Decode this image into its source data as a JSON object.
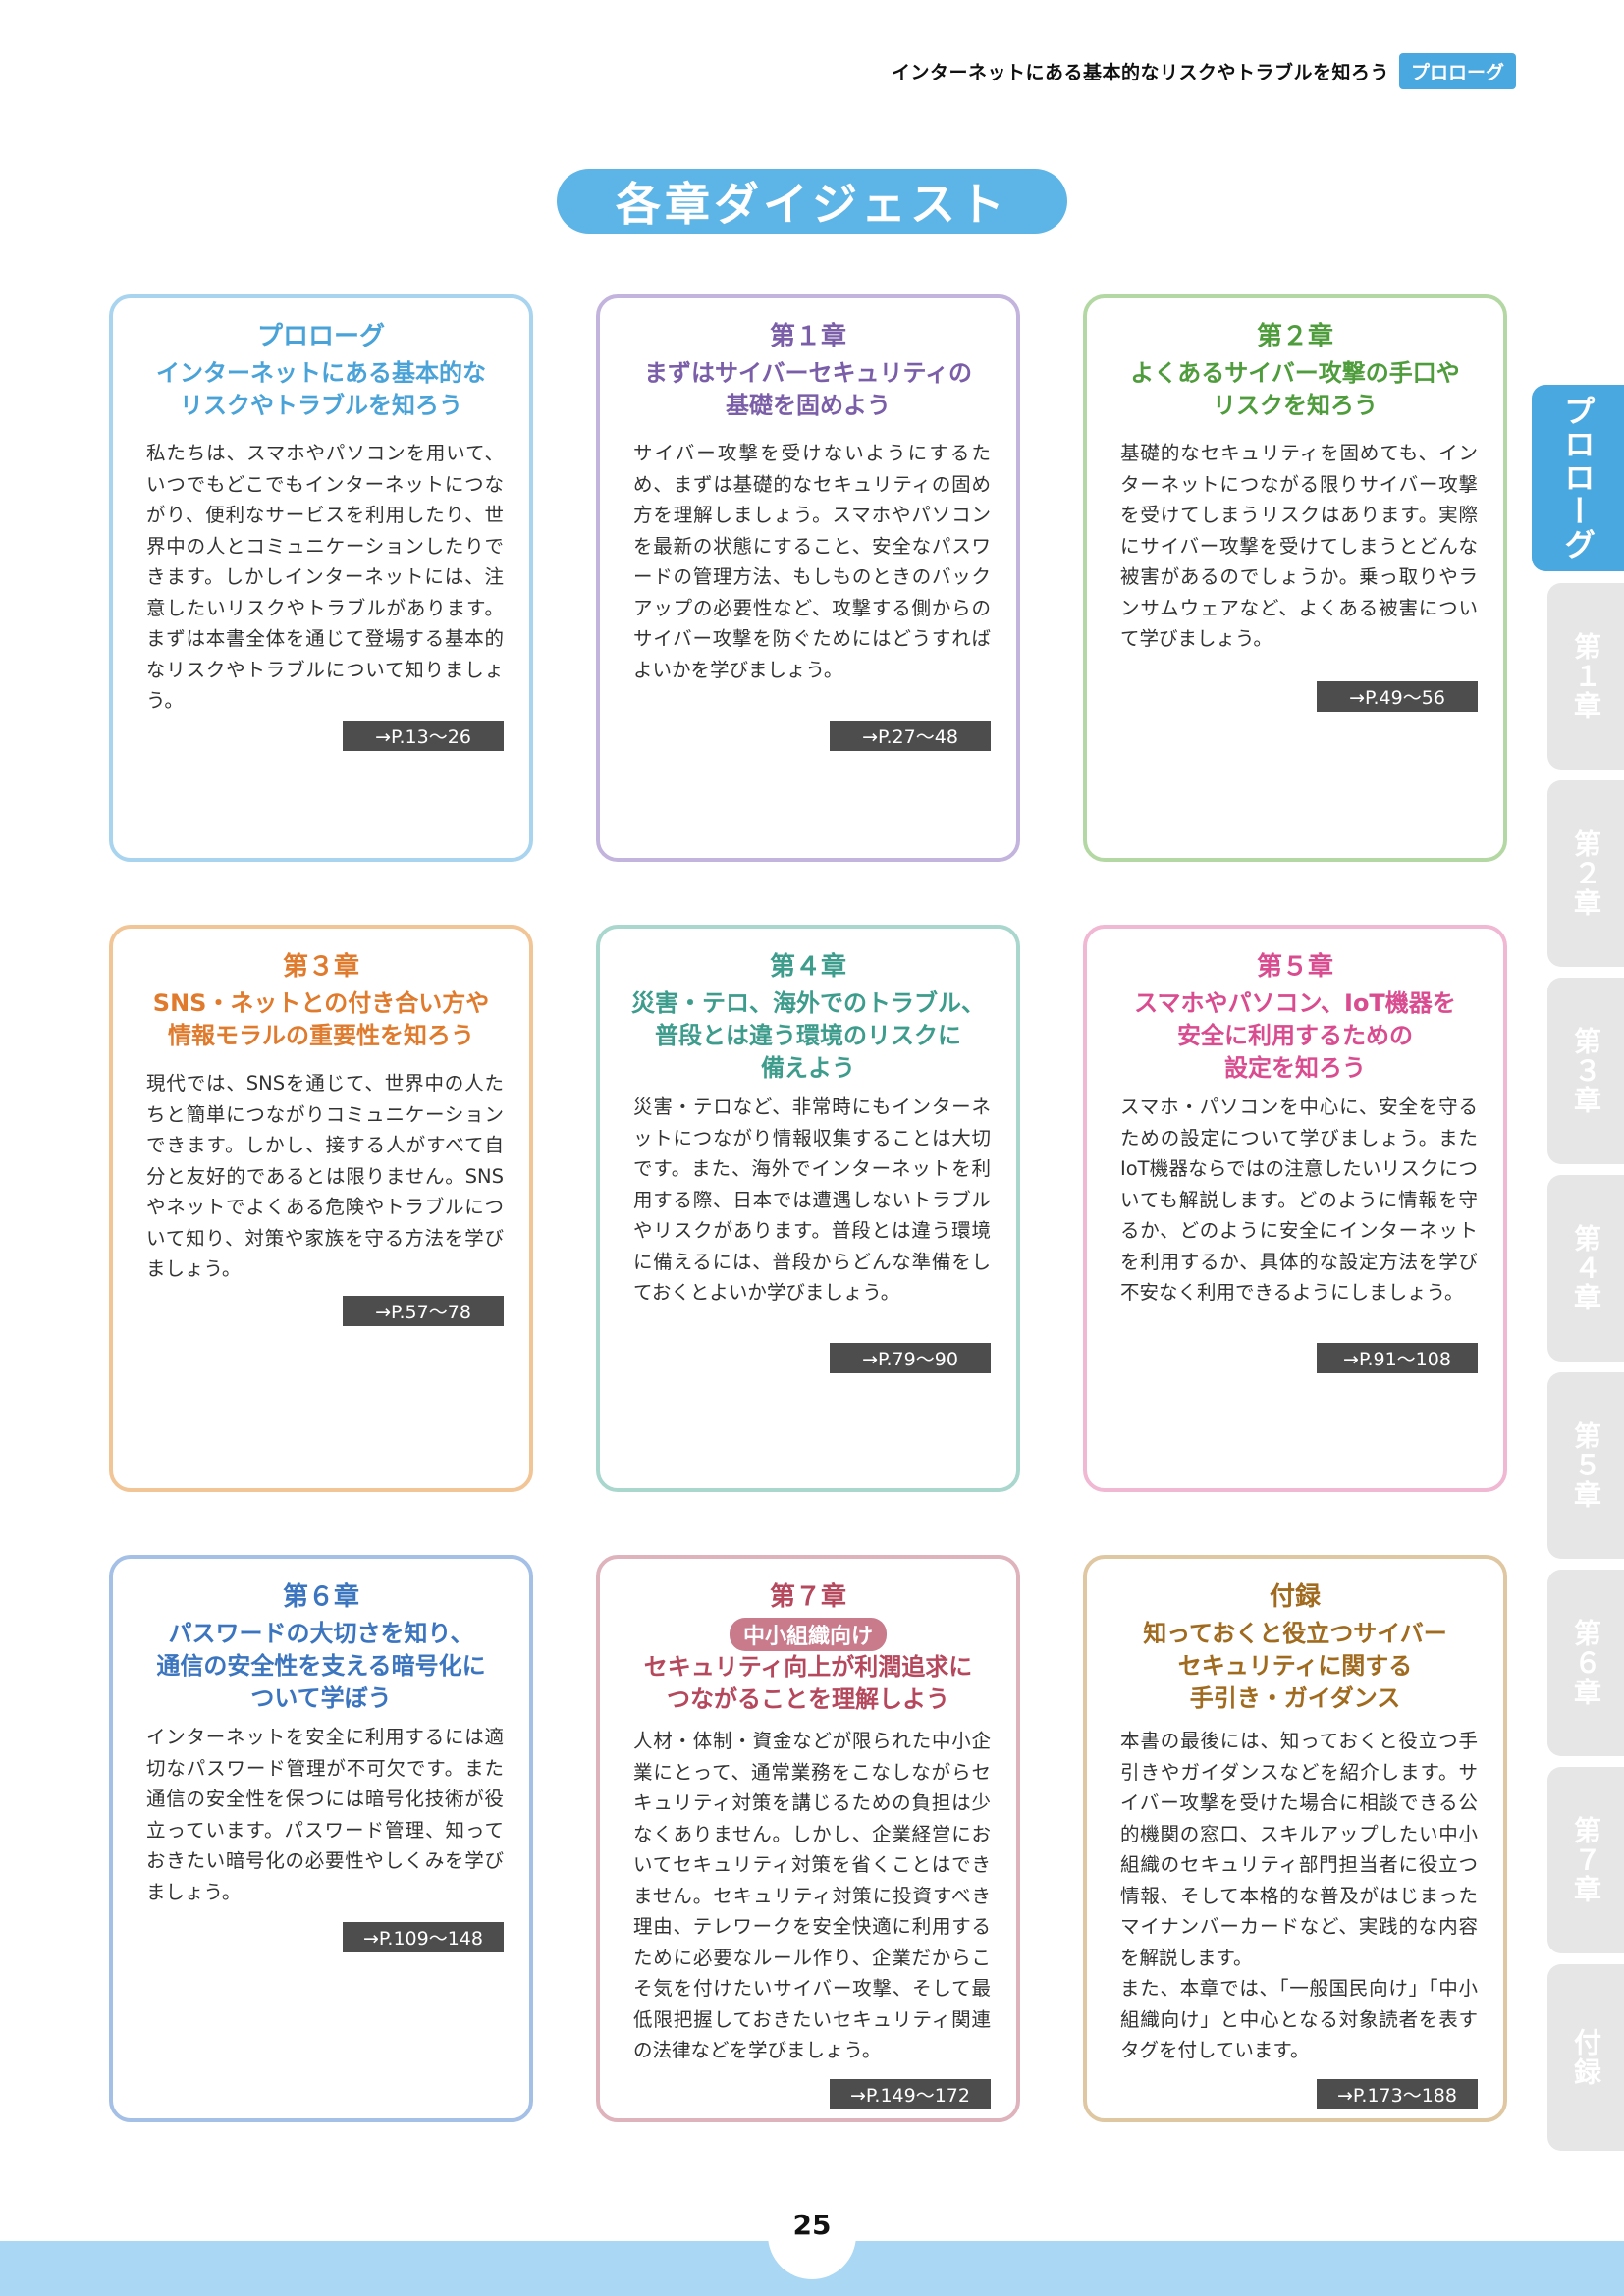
{
  "header": {
    "title": "インターネットにある基本的なリスクやトラブルを知ろう",
    "tag": "プロローグ"
  },
  "page_title": "各章ダイジェスト",
  "cards": [
    {
      "chapter": "プロローグ",
      "heading": "インターネットにある基本的な\nリスクやトラブルを知ろう",
      "body": "私たちは、スマホやパソコンを用いて、いつでもどこでもインターネットにつながり、便利なサービスを利用したり、世界中の人とコミュニケーションしたりできます。しかしインターネットには、注意したいリスクやトラブルがあります。まずは本書全体を通じて登場する基本的なリスクやトラブルについて知りましょう。",
      "pages": "→P.13〜26",
      "color": "#4aa3d8",
      "border": "#a9d4ef"
    },
    {
      "chapter": "第１章",
      "heading": "まずはサイバーセキュリティの\n基礎を固めよう",
      "body": "サイバー攻撃を受けないようにするため、まずは基礎的なセキュリティの固め方を理解しましょう。スマホやパソコンを最新の状態にすること、安全なパスワードの管理方法、もしものときのバックアップの必要性など、攻撃する側からのサイバー攻撃を防ぐためにはどうすればよいかを学びましょう。",
      "pages": "→P.27〜48",
      "color": "#7a5ea8",
      "border": "#c3b4dd"
    },
    {
      "chapter": "第２章",
      "heading": "よくあるサイバー攻撃の手口や\nリスクを知ろう",
      "body": "基礎的なセキュリティを固めても、インターネットにつながる限りサイバー攻撃を受けてしまうリスクはあります。実際にサイバー攻撃を受けてしまうとどんな被害があるのでしょうか。乗っ取りやランサムウェアなど、よくある被害について学びましょう。",
      "pages": "→P.49〜56",
      "color": "#4f9c3c",
      "border": "#b4d8a3"
    },
    {
      "chapter": "第３章",
      "heading": "SNS・ネットとの付き合い方や\n情報モラルの重要性を知ろう",
      "body": "現代では、SNSを通じて、世界中の人たちと簡単につながりコミュニケーションできます。しかし、接する人がすべて自分と友好的であるとは限りません。SNSやネットでよくある危険やトラブルについて知り、対策や家族を守る方法を学びましょう。",
      "pages": "→P.57〜78",
      "color": "#e07a2c",
      "border": "#f2c597"
    },
    {
      "chapter": "第４章",
      "heading": "災害・テロ、海外でのトラブル、\n普段とは違う環境のリスクに\n備えよう",
      "body": "災害・テロなど、非常時にもインターネットにつながり情報収集することは大切です。また、海外でインターネットを利用する際、日本では遭遇しないトラブルやリスクがあります。普段とは違う環境に備えるには、普段からどんな準備をしておくとよいか学びましょう。",
      "pages": "→P.79〜90",
      "color": "#3d9c8c",
      "border": "#a9d6cd"
    },
    {
      "chapter": "第５章",
      "heading": "スマホやパソコン、IoT機器を\n安全に利用するための\n設定を知ろう",
      "body": "スマホ・パソコンを中心に、安全を守るための設定について学びましょう。またIoT機器ならではの注意したいリスクについても解説します。どのように情報を守るか、どのように安全にインターネットを利用するか、具体的な設定方法を学び不安なく利用できるようにしましょう。",
      "pages": "→P.91〜108",
      "color": "#d94c8f",
      "border": "#f0b8d2"
    },
    {
      "chapter": "第６章",
      "heading": "パスワードの大切さを知り、\n通信の安全性を支える暗号化に\nついて学ぼう",
      "body": "インターネットを安全に利用するには適切なパスワード管理が不可欠です。また通信の安全性を保つには暗号化技術が役立っています。パスワード管理、知っておきたい暗号化の必要性やしくみを学びましょう。",
      "pages": "→P.109〜148",
      "color": "#3b74bf",
      "border": "#a5c0e6"
    },
    {
      "chapter": "第７章",
      "tag": "中小組織向け",
      "heading": "セキュリティ向上が利潤追求に\nつながることを理解しよう",
      "body": "人材・体制・資金などが限られた中小企業にとって、通常業務をこなしながらセキュリティ対策を講じるための負担は少なくありません。しかし、企業経営においてセキュリティ対策を省くことはできません。セキュリティ対策に投資すべき理由、テレワークを安全快適に利用するために必要なルール作り、企業だからこそ気を付けたいサイバー攻撃、そして最低限把握しておきたいセキュリティ関連の法律などを学びましょう。",
      "pages": "→P.149〜172",
      "color": "#b5485d",
      "border": "#dfb3bc"
    },
    {
      "chapter": "付録",
      "heading": "知っておくと役立つサイバー\nセキュリティに関する\n手引き・ガイダンス",
      "body": "本書の最後には、知っておくと役立つ手引きやガイダンスなどを紹介します。サイバー攻撃を受けた場合に相談できる公的機関の窓口、スキルアップしたい中小組織のセキュリティ部門担当者に役立つ情報、そして本格的な普及がはじまったマイナンバーカードなど、実践的な内容を解説します。\nまた、本章では、「一般国民向け」「中小組織向け」と中心となる対象読者を表すタグを付しています。",
      "pages": "→P.173〜188",
      "color": "#a06a1f",
      "border": "#dfc7a2"
    }
  ],
  "side_tabs": [
    "プロローグ",
    "第１章",
    "第２章",
    "第３章",
    "第４章",
    "第５章",
    "第６章",
    "第７章",
    "付録"
  ],
  "page_number": "25",
  "colors": {
    "accent": "#4aa8e0",
    "tab_inactive": "#e6e6e6",
    "footer": "#aad7f4"
  }
}
